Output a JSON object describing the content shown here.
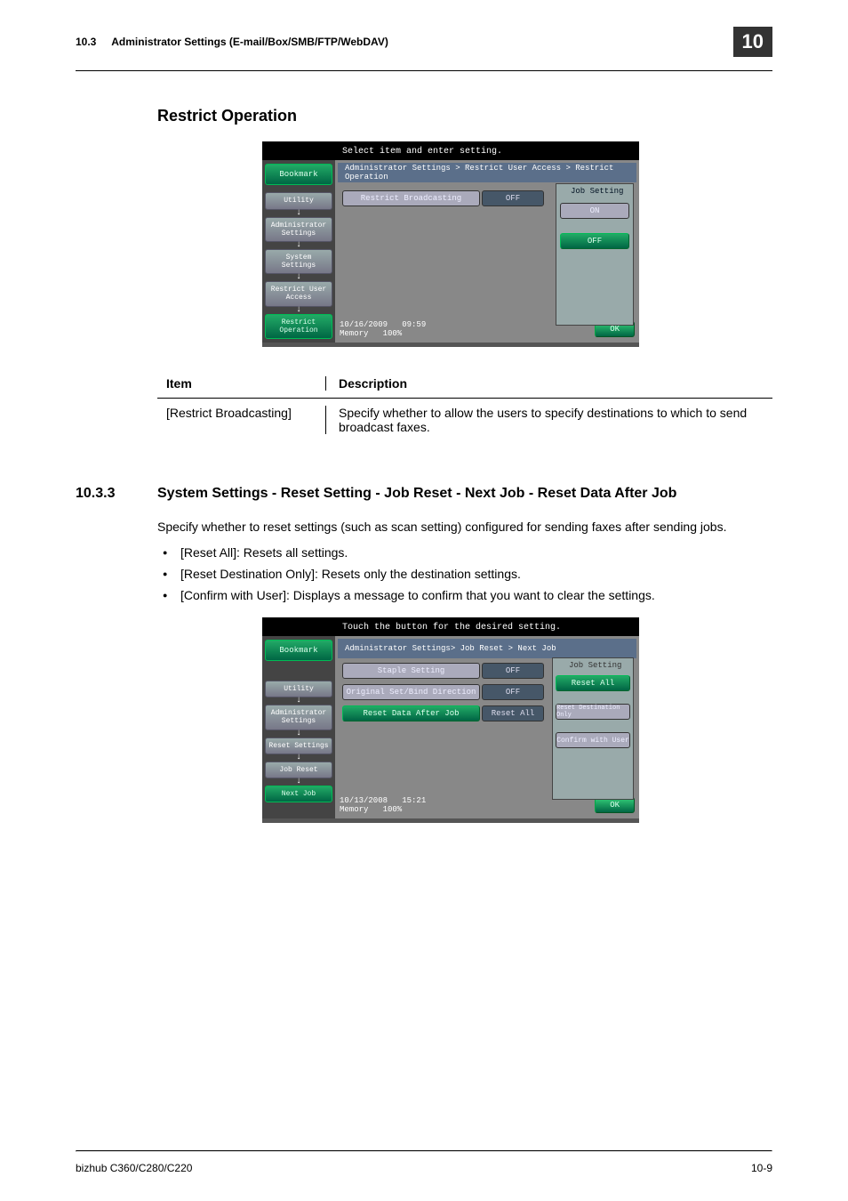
{
  "header": {
    "section": "10.3",
    "title": "Administrator Settings (E-mail/Box/SMB/FTP/WebDAV)",
    "chapter": "10"
  },
  "section1": {
    "heading": "Restrict Operation",
    "panel": {
      "instruction": "Select item and enter setting.",
      "bookmark": "Bookmark",
      "breadcrumb": "Administrator Settings > Restrict User Access > Restrict Operation",
      "sidebar": [
        "Utility",
        "Administrator Settings",
        "System Settings",
        "Restrict User Access",
        "Restrict Operation"
      ],
      "row_label": "Restrict Broadcasting",
      "row_val": "OFF",
      "right_title": "Job Setting",
      "opt_on": "ON",
      "opt_off": "OFF",
      "date": "10/16/2009",
      "time": "09:59",
      "mem_label": "Memory",
      "mem_val": "100%",
      "ok": "OK"
    },
    "table": {
      "h_item": "Item",
      "h_desc": "Description",
      "r_item": "[Restrict Broadcasting]",
      "r_desc": "Specify whether to allow the users to specify destinations to which to send broadcast faxes."
    }
  },
  "section2": {
    "number": "10.3.3",
    "heading": "System Settings - Reset Setting - Job Reset - Next Job - Reset Data After Job",
    "intro": "Specify whether to reset settings (such as scan setting) configured for sending faxes after sending jobs.",
    "bullets": [
      "[Reset All]: Resets all settings.",
      "[Reset Destination Only]: Resets only the destination settings.",
      "[Confirm with User]: Displays a message to confirm that you want to clear the settings."
    ],
    "panel": {
      "instruction": "Touch the button for the desired setting.",
      "bookmark": "Bookmark",
      "breadcrumb": "Administrator Settings> Job Reset > Next Job",
      "sidebar": [
        "Utility",
        "Administrator Settings",
        "Reset Settings",
        "Job Reset",
        "Next Job"
      ],
      "rows": [
        {
          "label": "Staple Setting",
          "val": "OFF"
        },
        {
          "label": "Original Set/Bind Direction",
          "val": "OFF"
        },
        {
          "label": "Reset Data After Job",
          "val": "Reset All"
        }
      ],
      "right_title": "Job Setting",
      "opts": [
        "Reset All",
        "Reset Destination Only",
        "Confirm with User"
      ],
      "date": "10/13/2008",
      "time": "15:21",
      "mem_label": "Memory",
      "mem_val": "100%",
      "ok": "OK"
    }
  },
  "footer": {
    "left": "bizhub C360/C280/C220",
    "right": "10-9"
  }
}
